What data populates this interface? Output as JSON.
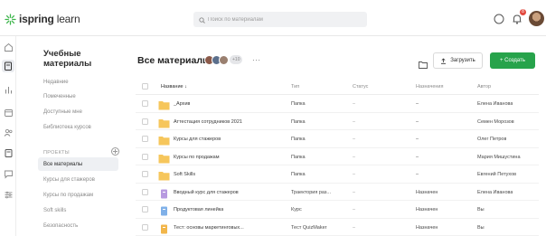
{
  "header": {
    "logo_text_bold": "ispring",
    "logo_text_light": " learn",
    "search_placeholder": "Поиск по материалам",
    "notification_count": "8",
    "colors": {
      "accent_green": "#27a34b",
      "logo_green": "#3cb54a",
      "badge_red": "#e2483d"
    }
  },
  "rail": {
    "icons": [
      "home-icon",
      "library-icon",
      "reports-icon",
      "calendar-icon",
      "users-icon",
      "assignments-icon",
      "chat-icon",
      "settings-icon"
    ]
  },
  "sidebar": {
    "title": "Учебные материалы",
    "links": [
      "Недавние",
      "Помеченные",
      "Доступные мне",
      "Библиотека курсов"
    ],
    "section_label": "ПРОЕКТЫ",
    "projects": [
      "Все материалы",
      "Курсы для стажеров",
      "Курсы по продажам",
      "Soft skills",
      "Безопасность"
    ],
    "active_project": "Все материалы"
  },
  "main": {
    "title": "Все материалы",
    "avatars_more": "+10",
    "more_dots": "···",
    "upload_label": "Загрузить",
    "create_label": "+ Создать"
  },
  "table": {
    "headers": {
      "name": "Название ↓",
      "type": "Тип",
      "status": "Статус",
      "assign": "Назначения",
      "author": "Автор"
    },
    "rows": [
      {
        "icon": "folder",
        "name": "_Архив",
        "type": "Папка",
        "status": "–",
        "assign": "–",
        "author": "Елена Иванова"
      },
      {
        "icon": "folder",
        "name": "Аттестация сотрудников 2021",
        "type": "Папка",
        "status": "–",
        "assign": "–",
        "author": "Семен Морозов"
      },
      {
        "icon": "folder",
        "name": "Курсы для стажеров",
        "type": "Папка",
        "status": "–",
        "assign": "–",
        "author": "Олег Петров"
      },
      {
        "icon": "folder",
        "name": "Курсы по продажам",
        "type": "Папка",
        "status": "–",
        "assign": "–",
        "author": "Мария Мишустина"
      },
      {
        "icon": "folder",
        "name": "Soft Skills",
        "type": "Папка",
        "status": "–",
        "assign": "–",
        "author": "Евгений Петухов"
      },
      {
        "icon": "trajectory",
        "name": "Вводный курс для стажеров",
        "type": "Траектория раз...",
        "status": "–",
        "assign": "Назначен",
        "author": "Елена Иванова"
      },
      {
        "icon": "course",
        "name": "Продуктовая линейка",
        "type": "Курс",
        "status": "–",
        "assign": "Назначен",
        "author": "Вы"
      },
      {
        "icon": "quiz",
        "name": "Тест: основы маркетинговых...",
        "type": "Тест QuizMaker",
        "status": "–",
        "assign": "Назначен",
        "author": "Вы"
      }
    ]
  }
}
